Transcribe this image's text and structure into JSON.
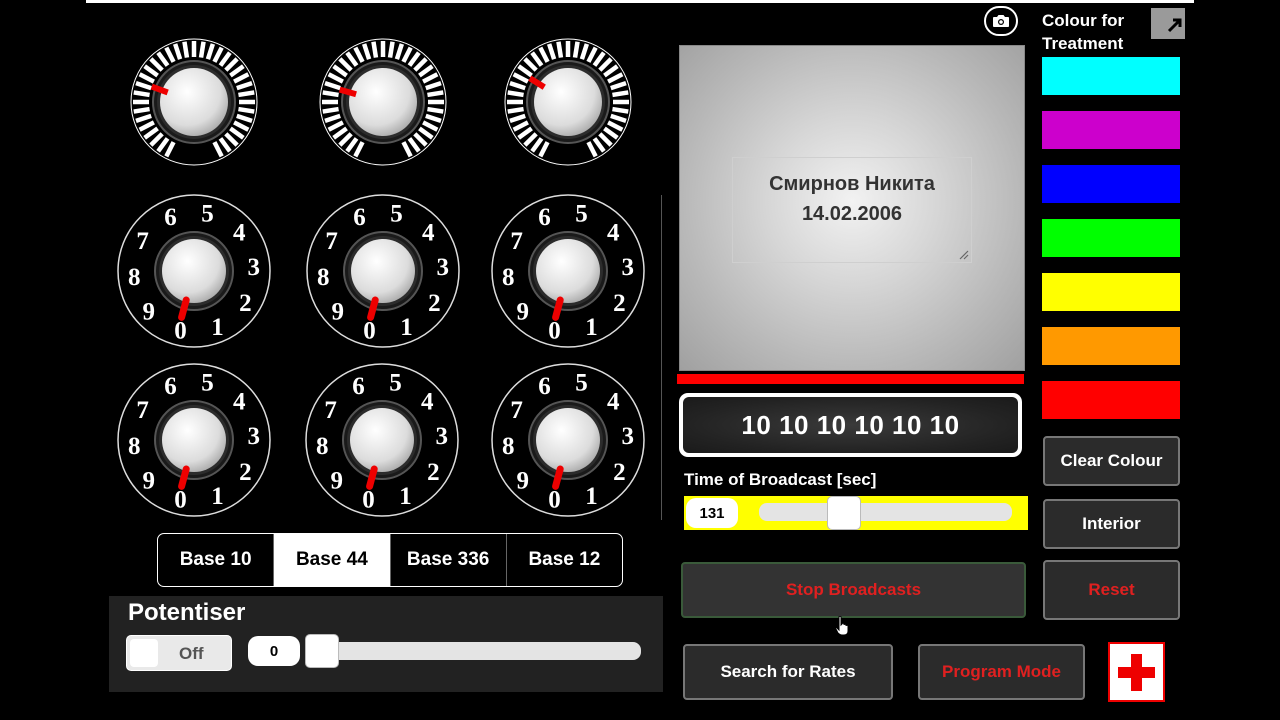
{
  "bases": [
    "Base 10",
    "Base 44",
    "Base 336",
    "Base 12"
  ],
  "active_base": 1,
  "digit_dial_numbers": [
    "0",
    "1",
    "2",
    "3",
    "4",
    "5",
    "6",
    "7",
    "8",
    "9"
  ],
  "potentiser": {
    "title": "Potentiser",
    "toggle_label": "Off",
    "value": "0"
  },
  "nameplate": {
    "name": "Смирнов Никита",
    "date": "14.02.2006"
  },
  "rate_display": "10 10 10 10 10 10",
  "broadcast": {
    "label": "Time of Broadcast [sec]",
    "value": "131"
  },
  "buttons": {
    "stop": "Stop Broadcasts",
    "search": "Search for Rates",
    "program": "Program Mode",
    "clear": "Clear Colour",
    "interior": "Interior",
    "reset": "Reset"
  },
  "colour_header": "Colour for Treatment",
  "colours": [
    "#00ffff",
    "#cc00cc",
    "#0000ff",
    "#00ff00",
    "#ffff00",
    "#ff9900",
    "#ff0000"
  ],
  "icons": {
    "camera": "camera-icon",
    "expand": "expand-arrow-icon",
    "cross": "red-cross-icon"
  }
}
